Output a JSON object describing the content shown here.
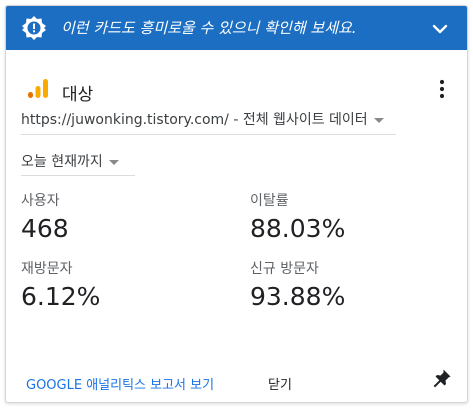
{
  "banner": {
    "text": "이런 카드도 흥미로울 수 있으니 확인해 보세요.",
    "icon": "badge-alert-icon",
    "chevron_icon": "chevron-down-icon"
  },
  "card": {
    "title": "대상",
    "logo_icon": "google-analytics-icon",
    "more_icon": "more-vert-icon",
    "property_selector": {
      "url": "https://juwonking.tistory.com/",
      "separator": " - ",
      "view": "전체 웹사이트 데이터"
    },
    "date_range": "오늘 현재까지",
    "stats": [
      {
        "label": "사용자",
        "value": "468"
      },
      {
        "label": "이탈률",
        "value": "88.03%"
      },
      {
        "label": "재방문자",
        "value": "6.12%"
      },
      {
        "label": "신규 방문자",
        "value": "93.88%"
      }
    ]
  },
  "footer": {
    "report_link": "GOOGLE 애널리틱스 보고서 보기",
    "close_label": "닫기",
    "pin_icon": "pin-icon"
  },
  "colors": {
    "banner_bg": "#1b6ec2",
    "link": "#1a73e8",
    "analytics_orange": "#f9ab00",
    "analytics_dark_orange": "#e37400"
  }
}
